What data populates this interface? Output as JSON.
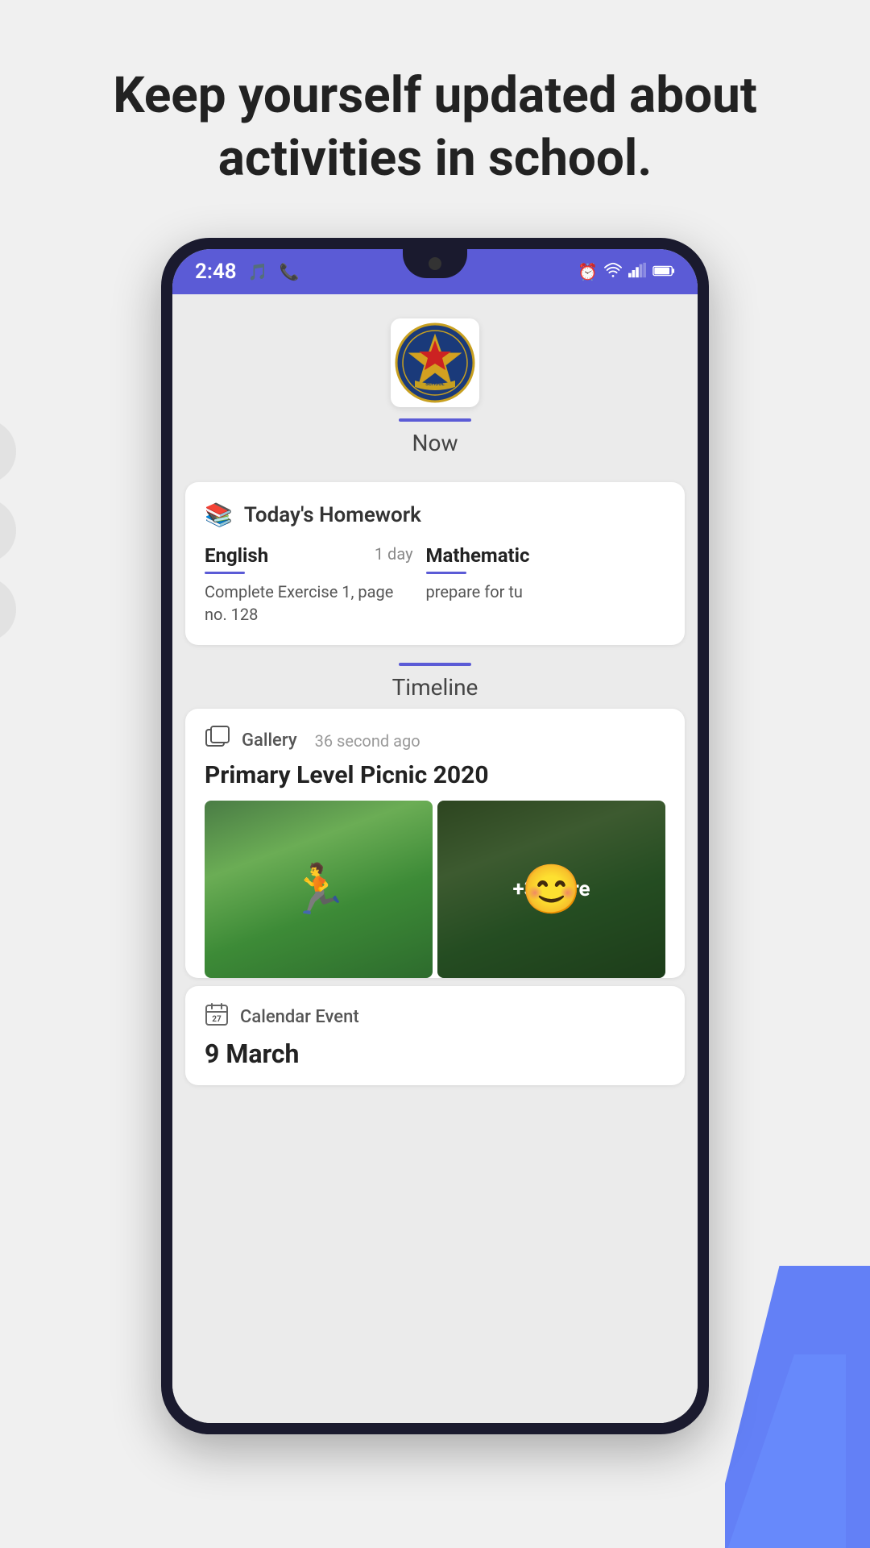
{
  "hero": {
    "title": "Keep yourself updated about activities in school."
  },
  "statusBar": {
    "time": "2:48",
    "leftIcons": [
      "spotify-icon",
      "whatsapp-icon"
    ],
    "rightIcons": [
      "alarm-icon",
      "wifi-icon",
      "signal-icon",
      "battery-icon"
    ]
  },
  "header": {
    "tabLabel": "Now"
  },
  "homework": {
    "cardTitle": "Today's Homework",
    "subjects": [
      {
        "name": "English",
        "duration": "1 day",
        "description": "Complete Exercise 1, page no. 128"
      },
      {
        "name": "Mathematic",
        "duration": "",
        "description": "prepare for tu"
      }
    ]
  },
  "timeline": {
    "tabLabel": "Timeline",
    "posts": [
      {
        "type": "Gallery",
        "time": "36 second ago",
        "title": "Primary Level Picnic 2020",
        "extraCount": "+3 more"
      },
      {
        "type": "Calendar Event",
        "date": "9 March",
        "description": ""
      }
    ]
  }
}
